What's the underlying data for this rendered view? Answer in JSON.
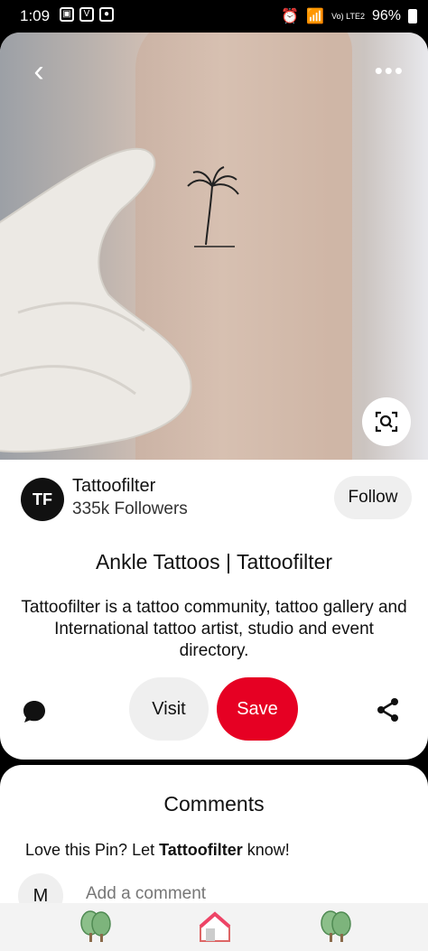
{
  "status_bar": {
    "time": "1:09",
    "battery": "96%",
    "network": "Vo) LTE2"
  },
  "pin": {
    "image_alt": "Palm tree tattoo on ankle",
    "title": "Ankle Tattoos | Tattoofilter",
    "description": "Tattoofilter is a tattoo community, tattoo gallery and International tattoo artist, studio and event directory."
  },
  "creator": {
    "name": "Tattoofilter",
    "followers": "335k Followers",
    "avatar_text": "TF",
    "follow_label": "Follow"
  },
  "actions": {
    "visit_label": "Visit",
    "save_label": "Save"
  },
  "comments": {
    "title": "Comments",
    "prompt_prefix": "Love this Pin? Let ",
    "prompt_name": "Tattoofilter",
    "prompt_suffix": " know!",
    "avatar_initial": "M",
    "placeholder": "Add a comment"
  },
  "colors": {
    "save": "#e60023",
    "grey_button": "#efefef"
  },
  "icons": [
    "back-icon",
    "more-icon",
    "visual-search-icon",
    "comment-icon",
    "share-icon",
    "tree-icon",
    "home-icon"
  ]
}
